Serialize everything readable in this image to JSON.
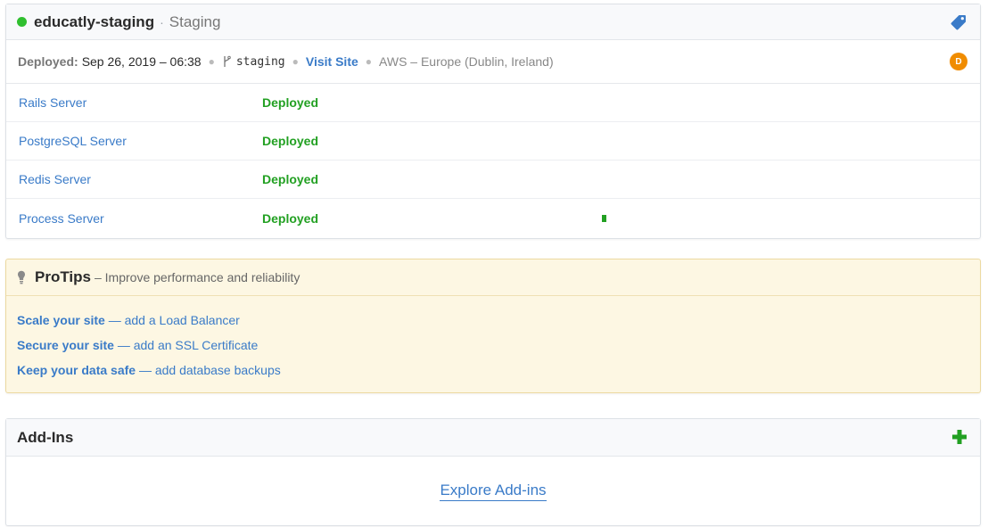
{
  "environment": {
    "name": "educatly-staging",
    "separator": "·",
    "type": "Staging",
    "status_color": "#2fbf2f",
    "tag_icon": "tag-icon"
  },
  "meta": {
    "deployed_label": "Deployed:",
    "deployed_date": "Sep 26, 2019 – 06:38",
    "branch_icon": "git-branch-icon",
    "branch": "staging",
    "visit_label": "Visit Site",
    "region": "AWS – Europe (Dublin, Ireland)",
    "avatar_initial": "D",
    "avatar_color": "#f08c00"
  },
  "servers": [
    {
      "name": "Rails Server",
      "status": "Deployed"
    },
    {
      "name": "PostgreSQL Server",
      "status": "Deployed"
    },
    {
      "name": "Redis Server",
      "status": "Deployed"
    },
    {
      "name": "Process Server",
      "status": "Deployed"
    }
  ],
  "protips": {
    "title": "ProTips",
    "subtitle": "– Improve performance and reliability",
    "icon": "lightbulb-icon",
    "tips": [
      {
        "strong": "Scale your site",
        "rest": " — add a Load Balancer"
      },
      {
        "strong": "Secure your site",
        "rest": " — add an SSL Certificate"
      },
      {
        "strong": "Keep your data safe",
        "rest": " — add database backups"
      }
    ]
  },
  "addins": {
    "title": "Add-Ins",
    "add_icon": "plus-icon",
    "explore_label": "Explore Add-ins"
  },
  "colors": {
    "link": "#3a7bc8",
    "success": "#22a022",
    "protips_bg": "#fdf7e3"
  }
}
